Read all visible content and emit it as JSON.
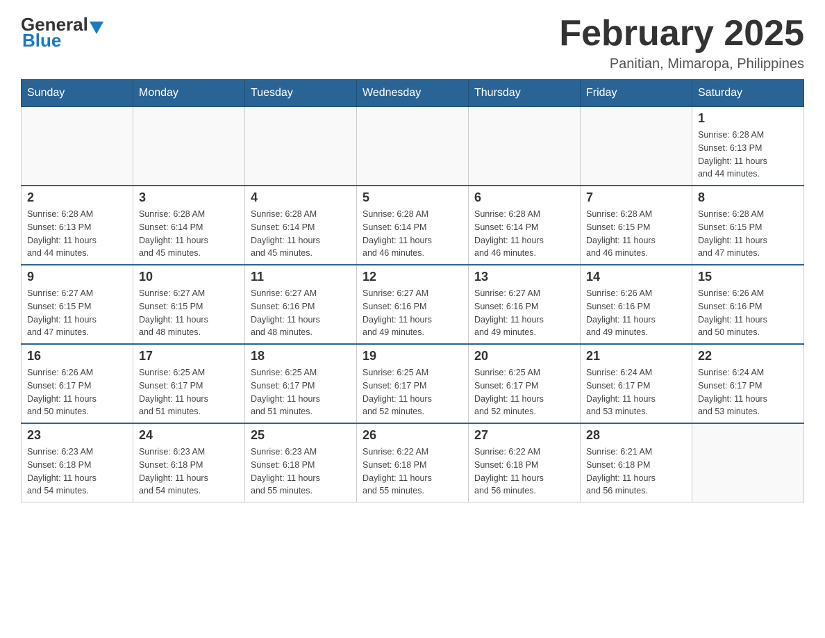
{
  "logo": {
    "general": "General",
    "blue": "Blue"
  },
  "title": "February 2025",
  "subtitle": "Panitian, Mimaropa, Philippines",
  "days_of_week": [
    "Sunday",
    "Monday",
    "Tuesday",
    "Wednesday",
    "Thursday",
    "Friday",
    "Saturday"
  ],
  "weeks": [
    [
      {
        "day": "",
        "info": ""
      },
      {
        "day": "",
        "info": ""
      },
      {
        "day": "",
        "info": ""
      },
      {
        "day": "",
        "info": ""
      },
      {
        "day": "",
        "info": ""
      },
      {
        "day": "",
        "info": ""
      },
      {
        "day": "1",
        "info": "Sunrise: 6:28 AM\nSunset: 6:13 PM\nDaylight: 11 hours\nand 44 minutes."
      }
    ],
    [
      {
        "day": "2",
        "info": "Sunrise: 6:28 AM\nSunset: 6:13 PM\nDaylight: 11 hours\nand 44 minutes."
      },
      {
        "day": "3",
        "info": "Sunrise: 6:28 AM\nSunset: 6:14 PM\nDaylight: 11 hours\nand 45 minutes."
      },
      {
        "day": "4",
        "info": "Sunrise: 6:28 AM\nSunset: 6:14 PM\nDaylight: 11 hours\nand 45 minutes."
      },
      {
        "day": "5",
        "info": "Sunrise: 6:28 AM\nSunset: 6:14 PM\nDaylight: 11 hours\nand 46 minutes."
      },
      {
        "day": "6",
        "info": "Sunrise: 6:28 AM\nSunset: 6:14 PM\nDaylight: 11 hours\nand 46 minutes."
      },
      {
        "day": "7",
        "info": "Sunrise: 6:28 AM\nSunset: 6:15 PM\nDaylight: 11 hours\nand 46 minutes."
      },
      {
        "day": "8",
        "info": "Sunrise: 6:28 AM\nSunset: 6:15 PM\nDaylight: 11 hours\nand 47 minutes."
      }
    ],
    [
      {
        "day": "9",
        "info": "Sunrise: 6:27 AM\nSunset: 6:15 PM\nDaylight: 11 hours\nand 47 minutes."
      },
      {
        "day": "10",
        "info": "Sunrise: 6:27 AM\nSunset: 6:15 PM\nDaylight: 11 hours\nand 48 minutes."
      },
      {
        "day": "11",
        "info": "Sunrise: 6:27 AM\nSunset: 6:16 PM\nDaylight: 11 hours\nand 48 minutes."
      },
      {
        "day": "12",
        "info": "Sunrise: 6:27 AM\nSunset: 6:16 PM\nDaylight: 11 hours\nand 49 minutes."
      },
      {
        "day": "13",
        "info": "Sunrise: 6:27 AM\nSunset: 6:16 PM\nDaylight: 11 hours\nand 49 minutes."
      },
      {
        "day": "14",
        "info": "Sunrise: 6:26 AM\nSunset: 6:16 PM\nDaylight: 11 hours\nand 49 minutes."
      },
      {
        "day": "15",
        "info": "Sunrise: 6:26 AM\nSunset: 6:16 PM\nDaylight: 11 hours\nand 50 minutes."
      }
    ],
    [
      {
        "day": "16",
        "info": "Sunrise: 6:26 AM\nSunset: 6:17 PM\nDaylight: 11 hours\nand 50 minutes."
      },
      {
        "day": "17",
        "info": "Sunrise: 6:25 AM\nSunset: 6:17 PM\nDaylight: 11 hours\nand 51 minutes."
      },
      {
        "day": "18",
        "info": "Sunrise: 6:25 AM\nSunset: 6:17 PM\nDaylight: 11 hours\nand 51 minutes."
      },
      {
        "day": "19",
        "info": "Sunrise: 6:25 AM\nSunset: 6:17 PM\nDaylight: 11 hours\nand 52 minutes."
      },
      {
        "day": "20",
        "info": "Sunrise: 6:25 AM\nSunset: 6:17 PM\nDaylight: 11 hours\nand 52 minutes."
      },
      {
        "day": "21",
        "info": "Sunrise: 6:24 AM\nSunset: 6:17 PM\nDaylight: 11 hours\nand 53 minutes."
      },
      {
        "day": "22",
        "info": "Sunrise: 6:24 AM\nSunset: 6:17 PM\nDaylight: 11 hours\nand 53 minutes."
      }
    ],
    [
      {
        "day": "23",
        "info": "Sunrise: 6:23 AM\nSunset: 6:18 PM\nDaylight: 11 hours\nand 54 minutes."
      },
      {
        "day": "24",
        "info": "Sunrise: 6:23 AM\nSunset: 6:18 PM\nDaylight: 11 hours\nand 54 minutes."
      },
      {
        "day": "25",
        "info": "Sunrise: 6:23 AM\nSunset: 6:18 PM\nDaylight: 11 hours\nand 55 minutes."
      },
      {
        "day": "26",
        "info": "Sunrise: 6:22 AM\nSunset: 6:18 PM\nDaylight: 11 hours\nand 55 minutes."
      },
      {
        "day": "27",
        "info": "Sunrise: 6:22 AM\nSunset: 6:18 PM\nDaylight: 11 hours\nand 56 minutes."
      },
      {
        "day": "28",
        "info": "Sunrise: 6:21 AM\nSunset: 6:18 PM\nDaylight: 11 hours\nand 56 minutes."
      },
      {
        "day": "",
        "info": ""
      }
    ]
  ],
  "accent_color": "#2a6496"
}
